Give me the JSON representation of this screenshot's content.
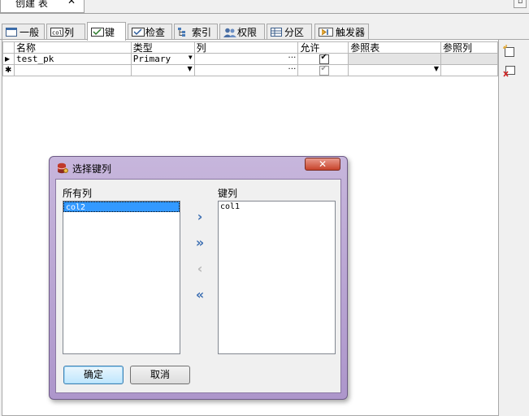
{
  "doc_tab": {
    "title": "创建 表",
    "close": "✕"
  },
  "tabs": [
    {
      "label": "一般",
      "icon": "window-icon"
    },
    {
      "label": "列",
      "icon": "column-icon"
    },
    {
      "label": "键",
      "icon": "key-check-icon"
    },
    {
      "label": "检查",
      "icon": "check-icon"
    },
    {
      "label": "索引",
      "icon": "index-icon"
    },
    {
      "label": "权限",
      "icon": "users-icon"
    },
    {
      "label": "分区",
      "icon": "table-icon"
    },
    {
      "label": "触发器",
      "icon": "trigger-icon"
    }
  ],
  "grid": {
    "headers": [
      "名称",
      "类型",
      "列",
      "允许",
      "参照表",
      "参照列"
    ],
    "rows": [
      {
        "marker": "▶",
        "name": "test_pk",
        "type": "Primary",
        "columns": "",
        "enabled": true,
        "ref_table": "",
        "ref_columns": ""
      },
      {
        "marker": "✱",
        "name": "",
        "type": "",
        "columns": "",
        "enabled": true,
        "ref_table": "",
        "ref_columns": ""
      }
    ]
  },
  "dialog": {
    "title": "选择键列",
    "close": "✕",
    "all_columns_label": "所有列",
    "key_columns_label": "键列",
    "all_columns": [
      "col2"
    ],
    "key_columns": [
      "col1"
    ],
    "arrows": {
      "add": "›",
      "add_all": "»",
      "remove": "‹",
      "remove_all": "«"
    },
    "ok": "确定",
    "cancel": "取消"
  }
}
